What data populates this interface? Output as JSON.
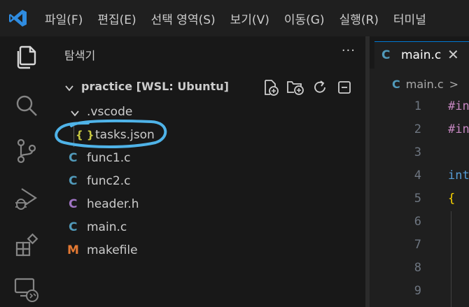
{
  "menu": [
    "파일(F)",
    "편집(E)",
    "선택 영역(S)",
    "보기(V)",
    "이동(G)",
    "실행(R)",
    "터미널"
  ],
  "explorer": {
    "title": "탐색기",
    "more": "···",
    "folder": "practice [WSL: Ubuntu]",
    "tree": [
      {
        "name": ".vscode",
        "icon": "chevron-down"
      },
      {
        "name": "tasks.json",
        "icon": "{ }"
      },
      {
        "name": "func1.c",
        "icon": "C"
      },
      {
        "name": "func2.c",
        "icon": "C"
      },
      {
        "name": "header.h",
        "icon": "C"
      },
      {
        "name": "main.c",
        "icon": "C"
      },
      {
        "name": "makefile",
        "icon": "M"
      }
    ]
  },
  "editor": {
    "tab": {
      "icon": "C",
      "label": "main.c",
      "close": "✕"
    },
    "breadcrumb": {
      "icon": "C",
      "label": "main.c",
      "sep": ">"
    },
    "line_numbers": [
      "1",
      "2",
      "3",
      "4",
      "5",
      "6",
      "7",
      "8",
      "9"
    ],
    "code": [
      "#in",
      "#in",
      "",
      "int",
      "{"
    ]
  },
  "colors": {
    "accent": "#0078d4",
    "c_file": "#519aba",
    "h_file": "#a074c4",
    "makefile": "#e37933",
    "json": "#cbcb41",
    "annotation": "#4fb3e8"
  }
}
